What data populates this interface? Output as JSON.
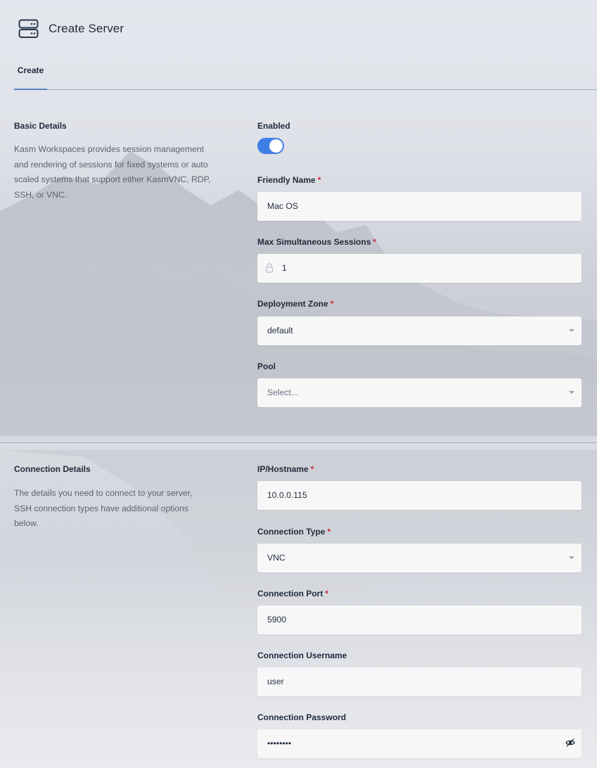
{
  "header": {
    "title": "Create Server",
    "icon": "server-icon"
  },
  "tabs": [
    {
      "label": "Create",
      "active": true
    }
  ],
  "basic_details": {
    "title": "Basic Details",
    "description": "Kasm Workspaces provides session management and rendering of sessions for fixed systems or auto scaled systems that support either KasmVNC, RDP, SSH, or VNC.",
    "enabled": {
      "label": "Enabled",
      "value": true,
      "color": "#3f7ee6"
    },
    "friendly_name": {
      "label": "Friendly Name",
      "required": "*",
      "value": "Mac OS"
    },
    "max_sessions": {
      "label": "Max Simultaneous Sessions",
      "required": "*",
      "value": "1",
      "icon": "lock-icon"
    },
    "deployment_zone": {
      "label": "Deployment Zone",
      "required": "*",
      "value": "default"
    },
    "pool": {
      "label": "Pool",
      "placeholder": "Select..."
    }
  },
  "connection_details": {
    "title": "Connection Details",
    "description": "The details you need to connect to your server, SSH connection types have additional options below.",
    "ip_hostname": {
      "label": "IP/Hostname",
      "required": "*",
      "value": "10.0.0.115"
    },
    "connection_type": {
      "label": "Connection Type",
      "required": "*",
      "value": "VNC"
    },
    "connection_port": {
      "label": "Connection Port",
      "required": "*",
      "value": "5900"
    },
    "connection_username": {
      "label": "Connection Username",
      "value": "user"
    },
    "connection_password": {
      "label": "Connection Password",
      "value": "••••••••",
      "icon": "eye-slash-icon"
    }
  }
}
